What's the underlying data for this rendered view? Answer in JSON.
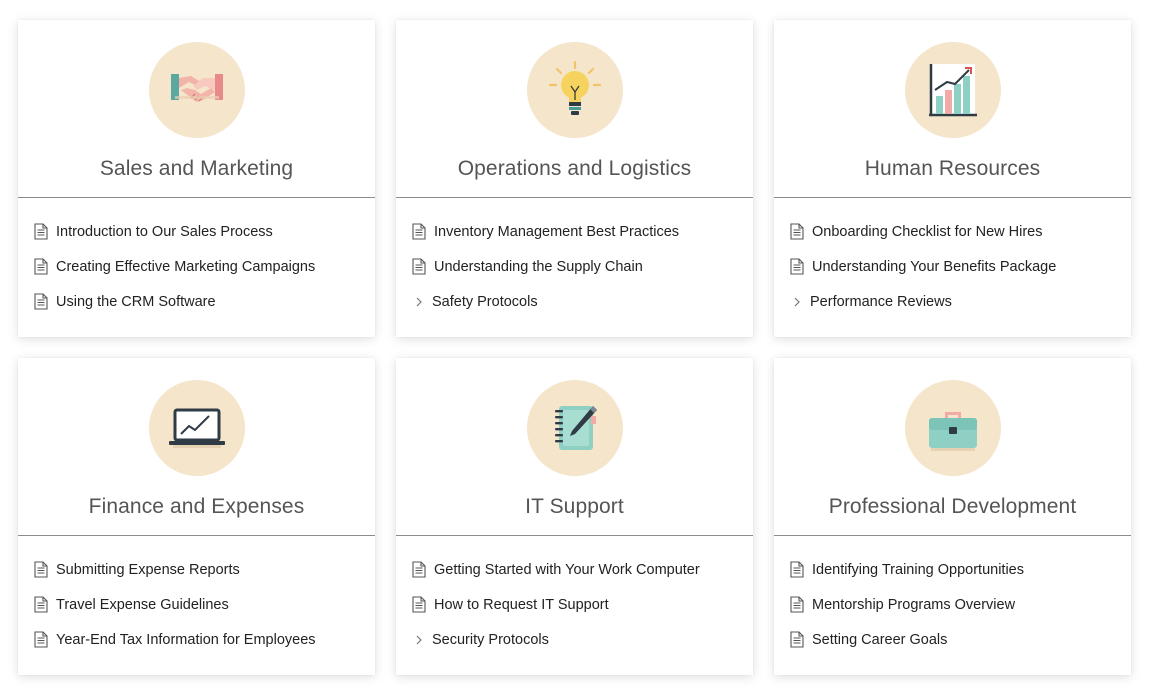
{
  "cards": [
    {
      "title": "Sales and Marketing",
      "icon": "handshake-icon",
      "items": [
        {
          "label": "Introduction to Our Sales Process",
          "type": "document"
        },
        {
          "label": "Creating Effective Marketing Campaigns",
          "type": "document"
        },
        {
          "label": "Using the CRM Software",
          "type": "document"
        }
      ]
    },
    {
      "title": "Operations and Logistics",
      "icon": "lightbulb-icon",
      "items": [
        {
          "label": "Inventory Management Best Practices",
          "type": "document"
        },
        {
          "label": "Understanding the Supply Chain",
          "type": "document"
        },
        {
          "label": "Safety Protocols",
          "type": "folder"
        }
      ]
    },
    {
      "title": "Human Resources",
      "icon": "growth-chart-icon",
      "items": [
        {
          "label": "Onboarding Checklist for New Hires",
          "type": "document"
        },
        {
          "label": "Understanding Your Benefits Package",
          "type": "document"
        },
        {
          "label": "Performance Reviews",
          "type": "folder"
        }
      ]
    },
    {
      "title": "Finance and Expenses",
      "icon": "laptop-chart-icon",
      "items": [
        {
          "label": "Submitting Expense Reports",
          "type": "document"
        },
        {
          "label": "Travel Expense Guidelines",
          "type": "document"
        },
        {
          "label": "Year-End Tax Information for Employees",
          "type": "document"
        }
      ]
    },
    {
      "title": "IT Support",
      "icon": "notebook-pen-icon",
      "items": [
        {
          "label": "Getting Started with Your Work Computer",
          "type": "document"
        },
        {
          "label": "How to Request IT Support",
          "type": "document"
        },
        {
          "label": "Security Protocols",
          "type": "folder"
        }
      ]
    },
    {
      "title": "Professional Development",
      "icon": "briefcase-icon",
      "items": [
        {
          "label": "Identifying Training Opportunities",
          "type": "document"
        },
        {
          "label": "Mentorship Programs Overview",
          "type": "document"
        },
        {
          "label": "Setting Career Goals",
          "type": "document"
        }
      ]
    }
  ],
  "colors": {
    "icon_circle": "#f4e5cb",
    "title_text": "#555555",
    "divider": "#8c8c8c"
  }
}
